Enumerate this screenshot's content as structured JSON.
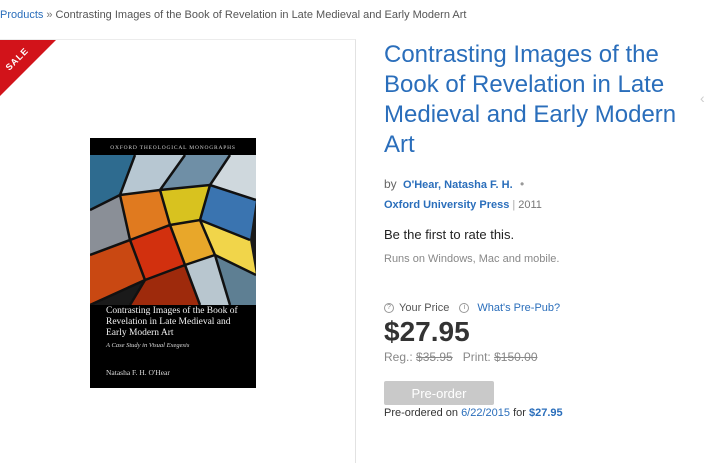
{
  "breadcrumb": {
    "root": "Products",
    "separator": "»",
    "current": "Contrasting Images of the Book of Revelation in Late Medieval and Early Modern Art"
  },
  "badge": {
    "label": "SALE",
    "color": "#d2131a"
  },
  "cover": {
    "series": "OXFORD THEOLOGICAL MONOGRAPHS",
    "title": "Contrasting Images of the Book of Revelation in Late Medieval and Early Modern Art",
    "subtitle": "A Case Study in Visual Exegesis",
    "author": "Natasha F. H. O'Hear"
  },
  "product": {
    "title": "Contrasting Images of the Book of Revelation in Late Medieval and Early Modern Art",
    "by_label": "by",
    "author": "O'Hear, Natasha F. H.",
    "publisher": "Oxford University Press",
    "year": "2011",
    "rating_text": "Be the first to rate this.",
    "platforms": "Runs on Windows, Mac and mobile."
  },
  "pricing": {
    "your_price_label": "Your Price",
    "prepub_link": "What's Pre-Pub?",
    "price": "$27.95",
    "regular_label": "Reg.:",
    "regular_price": "$35.95",
    "print_label": "Print:",
    "print_price": "$150.00",
    "preorder_button": "Pre-order",
    "preordered_prefix": "Pre-ordered on",
    "preordered_date": "6/22/2015",
    "preordered_for": "for",
    "preordered_amount": "$27.95"
  },
  "colors": {
    "link": "#2a6ebb",
    "button_disabled": "#c9c9c9"
  },
  "icons": {
    "info": "info-circle-icon",
    "next": "chevron-left-icon"
  }
}
